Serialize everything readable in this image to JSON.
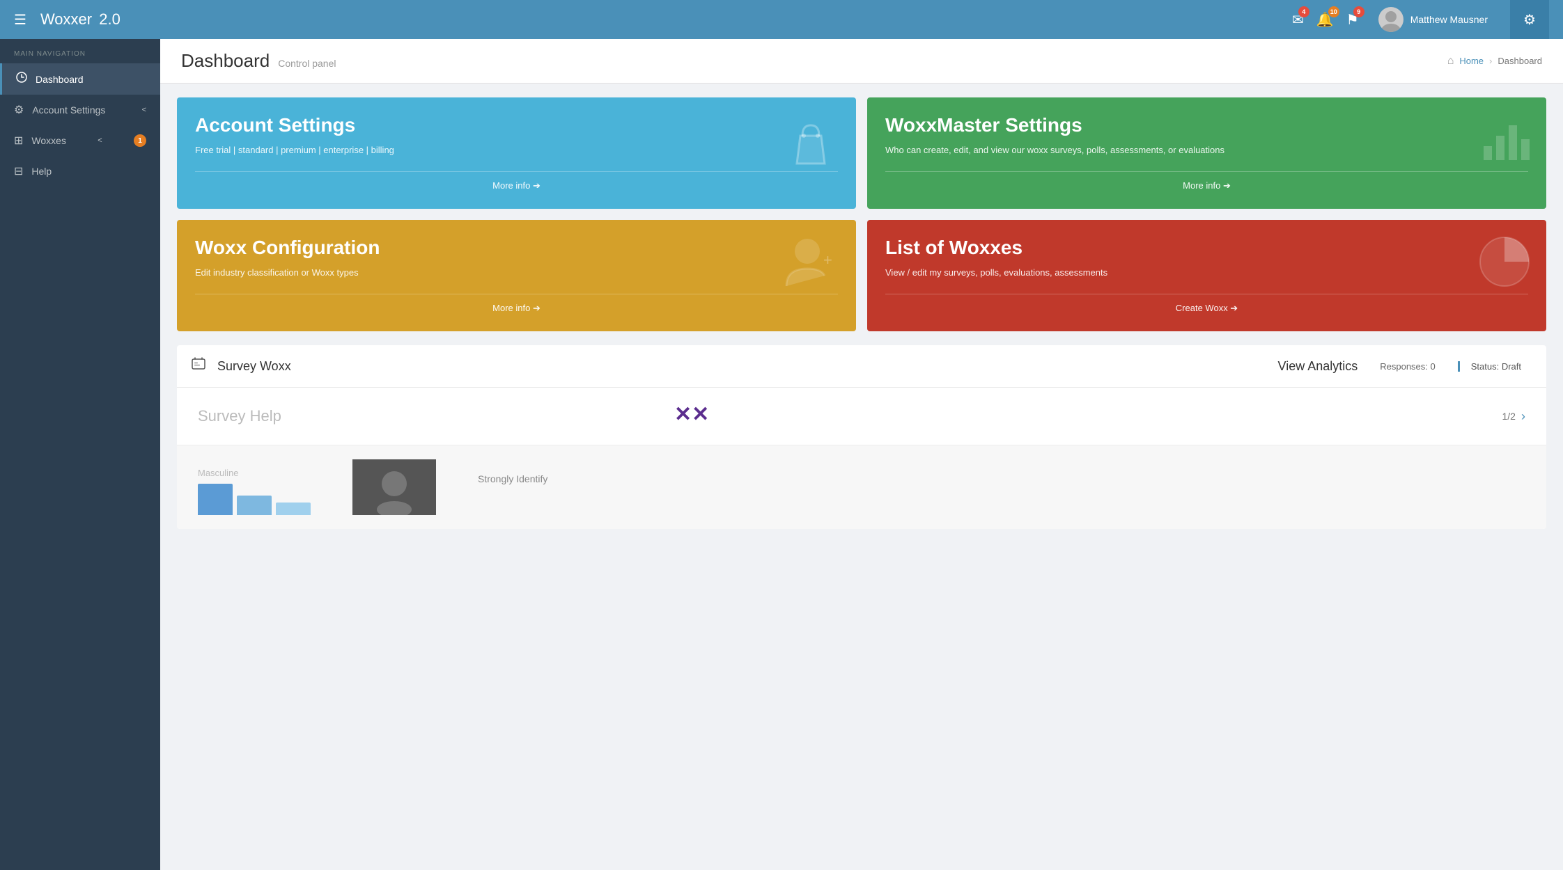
{
  "app": {
    "name": "Woxxer",
    "version": "2.0"
  },
  "topbar": {
    "menu_icon": "☰",
    "badges": {
      "mail": "4",
      "bell": "10",
      "flag": "9"
    },
    "user": {
      "name": "Matthew Mausner"
    },
    "gear_icon": "⚙"
  },
  "sidebar": {
    "section_label": "MAIN NAVIGATION",
    "items": [
      {
        "id": "dashboard",
        "label": "Dashboard",
        "icon": "dashboard",
        "active": true
      },
      {
        "id": "account-settings",
        "label": "Account Settings",
        "icon": "settings",
        "chevron": "<"
      },
      {
        "id": "woxxes",
        "label": "Woxxes",
        "icon": "grid",
        "chevron": "<",
        "badge": "1"
      },
      {
        "id": "help",
        "label": "Help",
        "icon": "help"
      }
    ]
  },
  "main": {
    "title": "Dashboard",
    "subtitle": "Control panel",
    "breadcrumb": {
      "home": "Home",
      "current": "Dashboard"
    }
  },
  "cards": [
    {
      "id": "account-settings",
      "title": "Account Settings",
      "description": "Free trial | standard | premium | enterprise | billing",
      "footer": "More info ➔",
      "color": "blue",
      "icon": "bag"
    },
    {
      "id": "woxxmaster-settings",
      "title": "WoxxMaster Settings",
      "description": "Who can create, edit, and view our woxx surveys, polls, assessments, or evaluations",
      "footer": "More info ➔",
      "color": "green",
      "icon": "chart"
    },
    {
      "id": "woxx-configuration",
      "title": "Woxx Configuration",
      "description": "Edit industry classification or Woxx types",
      "footer": "More info ➔",
      "color": "orange",
      "icon": "person"
    },
    {
      "id": "list-of-woxxes",
      "title": "List of Woxxes",
      "description": "View / edit my surveys, polls, evaluations, assessments",
      "footer": "Create Woxx ➔",
      "color": "red",
      "icon": "pie"
    }
  ],
  "survey": {
    "title": "Survey Woxx",
    "analytics_label": "View Analytics",
    "responses_label": "Responses: 0",
    "status_label": "Status: Draft",
    "help_title": "Survey Help",
    "logo": "✕✕",
    "page_nav": "1/2",
    "bar_label": "Masculine",
    "strongly_label": "Strongly Identify"
  }
}
